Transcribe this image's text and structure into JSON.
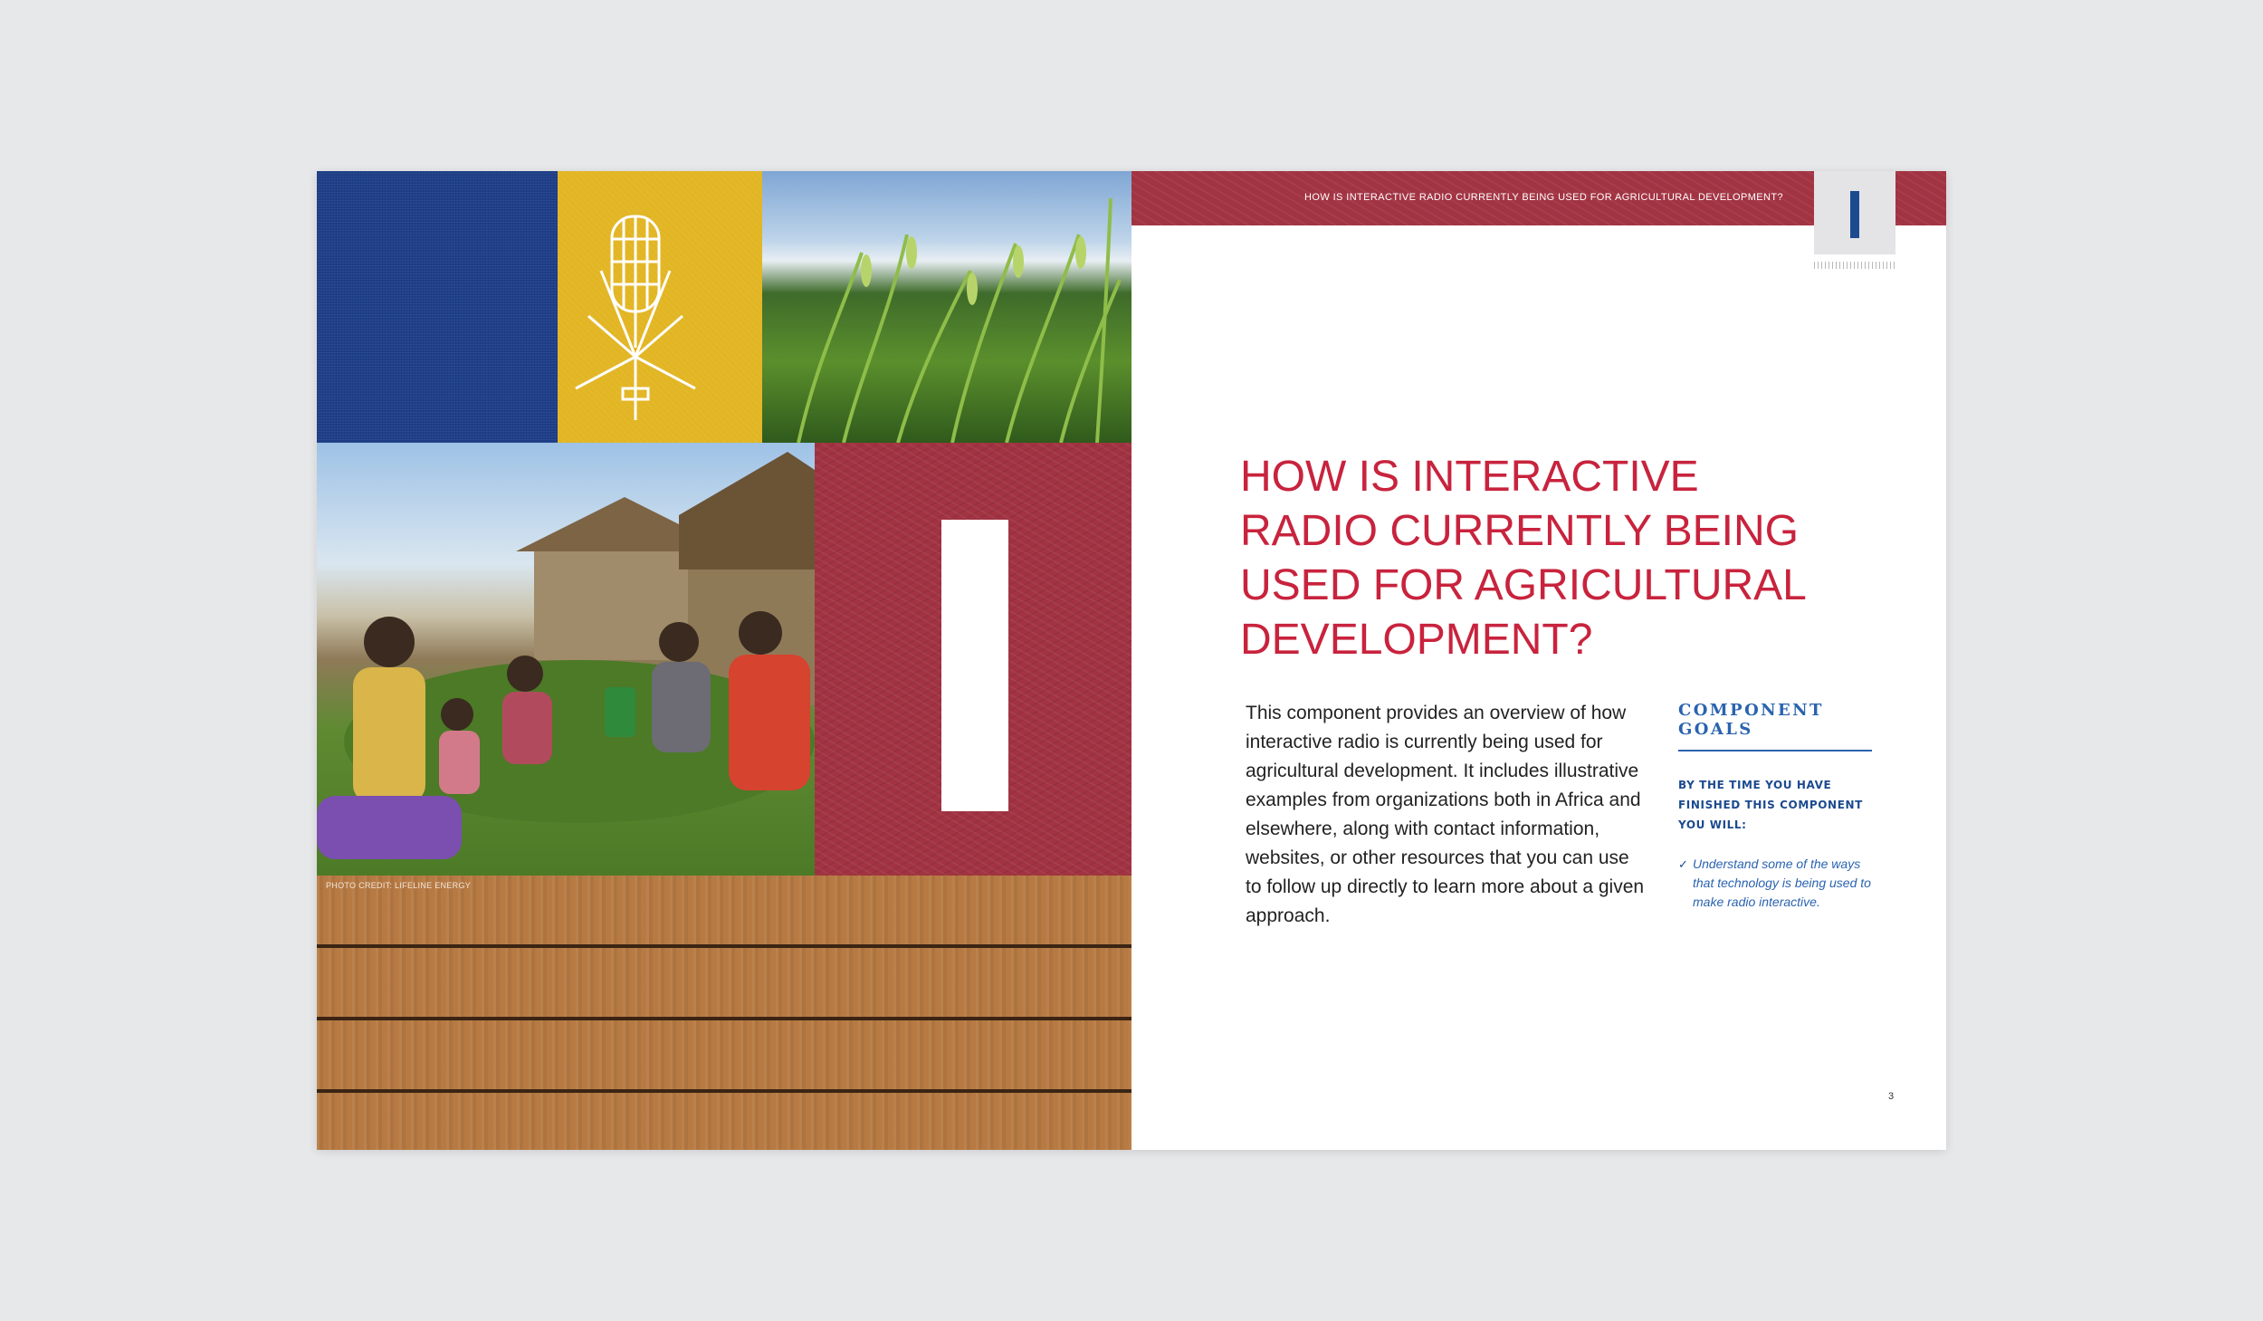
{
  "left_page": {
    "photo_credit": "PHOTO CREDIT: LIFELINE ENERGY"
  },
  "right_page": {
    "running_header": "HOW IS INTERACTIVE RADIO CURRENTLY BEING USED FOR AGRICULTURAL DEVELOPMENT?",
    "heading": "HOW IS INTERACTIVE RADIO CURRENTLY BEING USED FOR AGRICULTURAL DEVELOPMENT?",
    "intro": "This component provides an overview of how interactive radio is currently being used for agricultural development. It includes illustrative examples from organizations both in Africa and elsewhere, along with contact information, websites, or other resources that you can use to follow up directly to learn more about a given approach.",
    "goals": {
      "title": "COMPONENT GOALS",
      "subtitle": "BY THE TIME YOU HAVE FINISHED THIS COMPONENT YOU WILL:",
      "items": [
        "Understand some of the ways that technology is being used to make radio interactive."
      ]
    },
    "page_number": "3"
  },
  "colors": {
    "accent_red": "#c8233d",
    "band_red": "#a23342",
    "accent_blue": "#2a63b0",
    "fabric_blue": "#1f3f8a",
    "mustard": "#e2b523"
  }
}
